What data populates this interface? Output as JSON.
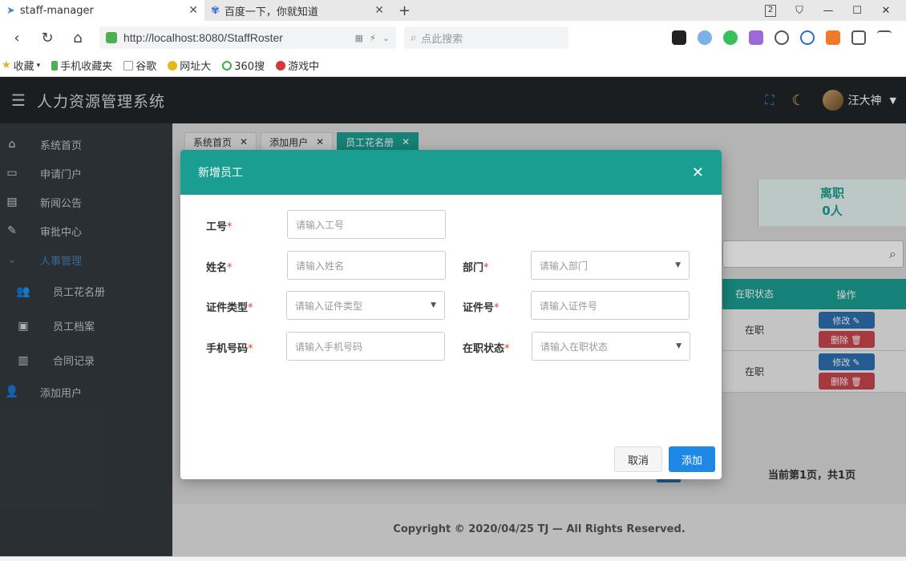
{
  "browser": {
    "tabs": [
      {
        "label": "staff-manager",
        "active": true
      },
      {
        "label": "百度一下，你就知道",
        "active": false
      }
    ],
    "tab_counter": "2",
    "url": "http://localhost:8080/StaffRoster",
    "search_placeholder": "点此搜索",
    "bookmarks": [
      "收藏",
      "手机收藏夹",
      "谷歌",
      "网址大",
      "360搜",
      "游戏中"
    ]
  },
  "app": {
    "title": "人力资源管理系统",
    "user_name": "汪大神"
  },
  "sidebar": {
    "items": [
      {
        "label": "系统首页",
        "icon": "home-icon"
      },
      {
        "label": "申请门户",
        "icon": "portal-icon"
      },
      {
        "label": "新闻公告",
        "icon": "news-icon"
      },
      {
        "label": "审批中心",
        "icon": "approval-icon"
      },
      {
        "label": "人事管理",
        "icon": "chevron-down-icon"
      },
      {
        "label": "员工花名册",
        "icon": "users-icon"
      },
      {
        "label": "员工档案",
        "icon": "profile-icon"
      },
      {
        "label": "合同记录",
        "icon": "contract-icon"
      },
      {
        "label": "添加用户",
        "icon": "user-add-icon"
      }
    ]
  },
  "content_tabs": [
    {
      "label": "系统首页"
    },
    {
      "label": "添加用户"
    },
    {
      "label": "员工花名册"
    }
  ],
  "stats": {
    "label": "离职",
    "value": "0人"
  },
  "table": {
    "headers": {
      "status": "在职状态",
      "ops": "操作"
    },
    "rows": [
      {
        "status": "在职",
        "edit": "修改",
        "delete": "删除"
      },
      {
        "status": "在职",
        "edit": "修改",
        "delete": "删除"
      }
    ]
  },
  "pagination": {
    "info": "当前第1页，共1页"
  },
  "footer": {
    "copyright": "Copyright © 2020/04/25 TJ — All Rights Reserved."
  },
  "modal": {
    "title": "新增员工",
    "fields": {
      "job_no": {
        "label": "工号",
        "placeholder": "请输入工号"
      },
      "name": {
        "label": "姓名",
        "placeholder": "请输入姓名"
      },
      "department": {
        "label": "部门",
        "placeholder": "请输入部门"
      },
      "id_type": {
        "label": "证件类型",
        "placeholder": "请输入证件类型"
      },
      "id_no": {
        "label": "证件号",
        "placeholder": "请输入证件号"
      },
      "phone": {
        "label": "手机号码",
        "placeholder": "请输入手机号码"
      },
      "status": {
        "label": "在职状态",
        "placeholder": "请输入在职状态"
      }
    },
    "cancel_label": "取消",
    "add_label": "添加"
  }
}
